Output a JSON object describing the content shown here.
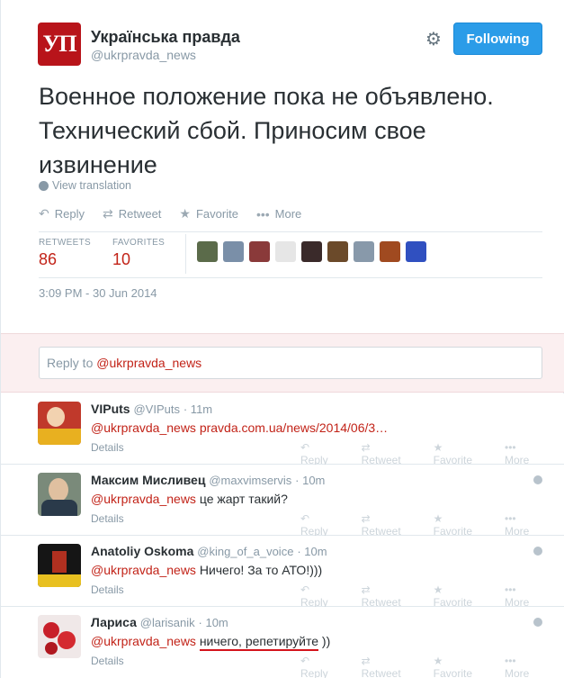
{
  "tweet": {
    "avatar_text": "УП",
    "fullname": "Українська правда",
    "screenname": "@ukrpravda_news",
    "follow_label": "Following",
    "text": "Военное положение пока не объявлено. Технический сбой. Приносим свое извинение",
    "translate_label": "View translation",
    "actions": {
      "reply": "Reply",
      "retweet": "Retweet",
      "favorite": "Favorite",
      "more": "More"
    },
    "stats": {
      "retweets_label": "RETWEETS",
      "retweets": "86",
      "favorites_label": "FAVORITES",
      "favorites": "10"
    },
    "timestamp": "3:09 PM - 30 Jun 2014",
    "face_colors": [
      "#5b6b4a",
      "#7a8fa8",
      "#8a3a3a",
      "#e6e6e6",
      "#3a2a2a",
      "#6b4a2a",
      "#8899aa",
      "#a04a20",
      "#3050c0"
    ]
  },
  "reply_box": {
    "prefix": "Reply to ",
    "mention": "@ukrpravda_news"
  },
  "replies": [
    {
      "name": "VIPuts",
      "screenname": "@VIPuts",
      "time": "· 11m",
      "mention": "@ukrpravda_news",
      "text": " pravda.com.ua/news/2014/06/3…",
      "details": "Details",
      "avatar_color": "#c0392b"
    },
    {
      "name": "Максим Мисливец",
      "screenname": "@maxvimservis",
      "time": "· 10m",
      "mention": "@ukrpravda_news",
      "text": " це жарт такий?",
      "details": "Details",
      "avatar_color": "#5a6a7a"
    },
    {
      "name": "Anatoliy Oskoma",
      "screenname": "@king_of_a_voice",
      "time": "· 10m",
      "mention": "@ukrpravda_news",
      "text": " Ничего! За то АТО!)))",
      "details": "Details",
      "avatar_color": "#1a1a1a"
    },
    {
      "name": "Лариса",
      "screenname": "@larisanik",
      "time": "· 10m",
      "mention": "@ukrpravda_news",
      "text_underlined": "ничего, репетируйте",
      "text_after": " ))",
      "details": "Details",
      "avatar_color": "#c0303a"
    }
  ],
  "reply_actions": {
    "reply": "Reply",
    "retweet": "Retweet",
    "favorite": "Favorite",
    "more": "More"
  }
}
